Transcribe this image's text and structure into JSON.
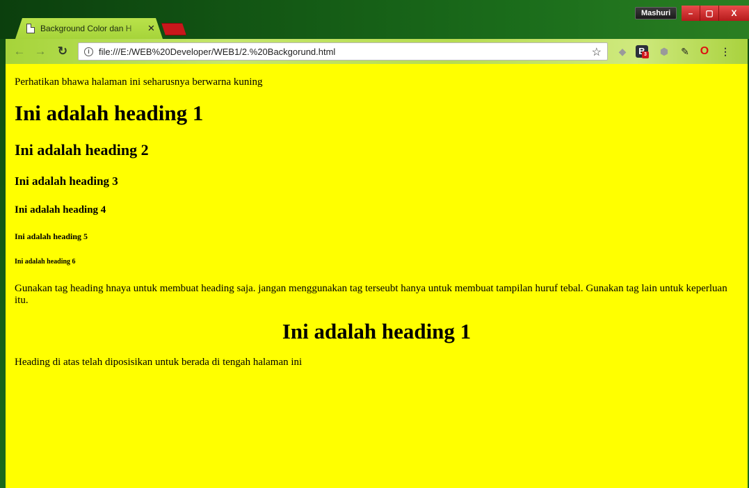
{
  "browser": {
    "tab_title": "Background Color dan H",
    "tab_close": "✕",
    "profile_name": "Mashuri",
    "window_controls": {
      "minimize": "–",
      "maximize": "▢",
      "close": "X"
    },
    "url": "file:///E:/WEB%20Developer/WEB1/2.%20Backgorund.html",
    "extension_badge": "3",
    "icons": [
      "back-icon",
      "forward-icon",
      "reload-icon",
      "info-icon",
      "star-icon",
      "extension-icon",
      "b-extension-icon",
      "eyedropper-icon",
      "opera-icon",
      "menu-icon"
    ]
  },
  "page": {
    "background_color": "#ffff00",
    "intro": "Perhatikan bhawa halaman ini seharusnya berwarna kuning",
    "headings": {
      "h1": "Ini adalah heading 1",
      "h2": "Ini adalah heading 2",
      "h3": "Ini adalah heading 3",
      "h4": "Ini adalah heading 4",
      "h5": "Ini adalah heading 5",
      "h6": "Ini adalah heading 6"
    },
    "advice": "Gunakan tag heading hnaya untuk membuat heading saja. jangan menggunakan tag terseubt hanya untuk membuat tampilan huruf tebal. Gunakan tag lain untuk keperluan itu.",
    "centered_heading": "Ini adalah heading 1",
    "centered_note": "Heading di atas telah diposisikan untuk berada di tengah halaman ini"
  }
}
